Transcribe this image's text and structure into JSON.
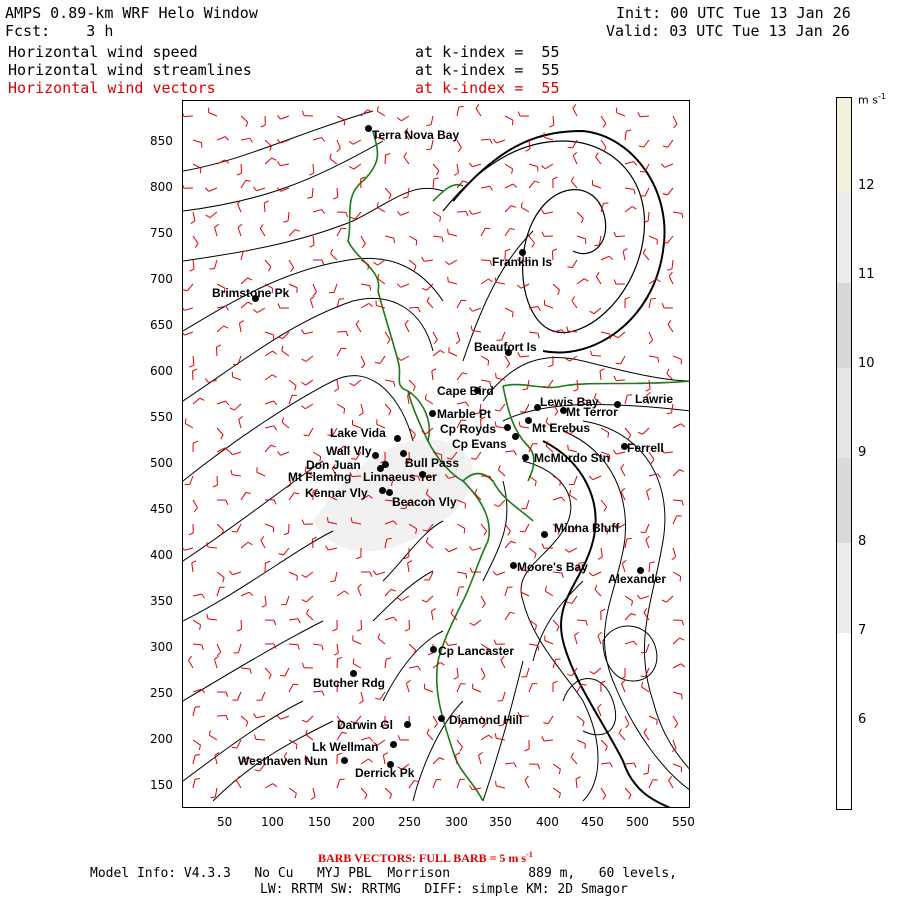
{
  "header": {
    "title": "AMPS 0.89-km WRF Helo Window",
    "init": "Init: 00 UTC Tue 13 Jan 26",
    "fcst_label": "Fcst:",
    "fcst_value": "3 h",
    "valid": "Valid: 03 UTC Tue 13 Jan 26"
  },
  "fields": [
    {
      "name": "Horizontal wind speed",
      "level": "at k-index =  55",
      "color": "#000000"
    },
    {
      "name": "Horizontal wind streamlines",
      "level": "at k-index =  55",
      "color": "#000000"
    },
    {
      "name": "Horizontal wind vectors",
      "level": "at k-index =  55",
      "color": "#e00000"
    }
  ],
  "axes": {
    "x_ticks": [
      "50",
      "100",
      "150",
      "200",
      "250",
      "300",
      "350",
      "400",
      "450",
      "500",
      "550"
    ],
    "y_ticks": [
      "850",
      "800",
      "750",
      "700",
      "650",
      "600",
      "550",
      "500",
      "450",
      "400",
      "350",
      "300",
      "250",
      "200",
      "150"
    ]
  },
  "colorbar": {
    "unit": "m s",
    "unit_exp": "-1",
    "labels": [
      "12",
      "11",
      "10",
      "9",
      "8",
      "7",
      "6"
    ],
    "colors": [
      "#f2f2dc",
      "#ececec",
      "#d8d8d8",
      "#e6e6e6",
      "#dadada",
      "#ececec",
      "#ffffff"
    ]
  },
  "places": [
    {
      "name": "Terra Nova Bay"
    },
    {
      "name": "Franklin Is"
    },
    {
      "name": "Brimstone Pk"
    },
    {
      "name": "Beaufort Is"
    },
    {
      "name": "Cape Bird"
    },
    {
      "name": "Lewis Bay"
    },
    {
      "name": "Lawrie"
    },
    {
      "name": "Mt Terror"
    },
    {
      "name": "Marble Pt"
    },
    {
      "name": "Cp Royds"
    },
    {
      "name": "Mt Erebus"
    },
    {
      "name": "Lake Vida"
    },
    {
      "name": "Cp Evans"
    },
    {
      "name": "Ferrell"
    },
    {
      "name": "Wall Vly"
    },
    {
      "name": "Bull Pass"
    },
    {
      "name": "McMurdo Stn"
    },
    {
      "name": "Don Juan"
    },
    {
      "name": "Mt Fleming"
    },
    {
      "name": "Linnaeus Ter"
    },
    {
      "name": "Kennar Vly"
    },
    {
      "name": "Beacon Vly"
    },
    {
      "name": "Minna Bluff"
    },
    {
      "name": "Moore's Bay"
    },
    {
      "name": "Alexander"
    },
    {
      "name": "Cp Lancaster"
    },
    {
      "name": "Butcher Rdg"
    },
    {
      "name": "Darwin Gl"
    },
    {
      "name": "Diamond Hill"
    },
    {
      "name": "Lk Wellman"
    },
    {
      "name": "Westhaven Nun"
    },
    {
      "name": "Derrick Pk"
    }
  ],
  "footer": {
    "barb_note": "BARB VECTORS:  FULL BARB = 5 m s",
    "barb_exp": "-1",
    "line1": "Model Info: V4.3.3   No Cu   MYJ PBL  Morrison          889 m,   60 levels,",
    "line2": "LW: RRTM SW: RRTMG   DIFF: simple KM: 2D Smagor"
  }
}
